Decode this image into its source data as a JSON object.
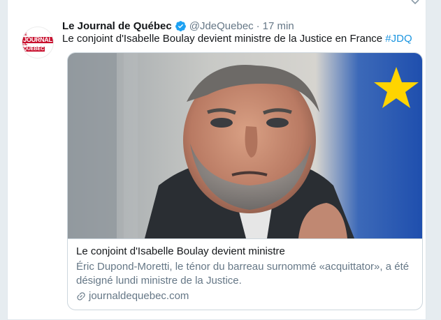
{
  "tweet": {
    "author_name": "Le Journal de Québec",
    "handle": "@JdeQuebec",
    "separator": "·",
    "time": "17 min",
    "text": "Le conjoint d'Isabelle Boulay devient ministre de la Justice en France ",
    "hashtag": "#JDQ",
    "avatar_logo": {
      "line1": "LE",
      "line2": "JOURNAL",
      "line3": "DE",
      "line4": "QUÉBEC"
    }
  },
  "card": {
    "title": "Le conjoint d'Isabelle Boulay devient ministre",
    "description": "Éric Dupond-Moretti, le ténor du barreau surnommé «acquittator», a été désigné lundi ministre de la Justice.",
    "domain": "journaldequebec.com"
  },
  "colors": {
    "brand_red": "#c8102e",
    "twitter_blue": "#1da1f2",
    "link_blue": "#1b95e0",
    "secondary_text": "#657786"
  }
}
